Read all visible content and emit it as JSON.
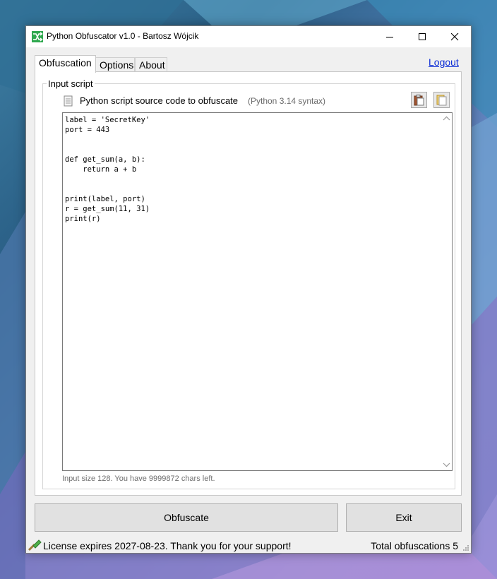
{
  "window": {
    "title": "Python Obfuscator v1.0 - Bartosz Wójcik"
  },
  "tabs": [
    {
      "label": "Obfuscation",
      "active": true
    },
    {
      "label": "Options",
      "active": false
    },
    {
      "label": "About",
      "active": false
    }
  ],
  "logout_label": "Logout",
  "input_group": {
    "label": "Input script",
    "source_label": "Python script source code to obfuscate",
    "syntax_label": "(Python 3.14 syntax)",
    "paste_icon": "clipboard-paste-icon",
    "open_icon": "open-file-icon",
    "code_lines": [
      "label = 'SecretKey'",
      "port = 443",
      "",
      "",
      "def get_sum(a, b):",
      "    return a + b",
      "",
      "",
      "print(label, port)",
      "r = get_sum(11, 31)",
      "print(r)"
    ],
    "size_text": "Input size 128. You have 9999872 chars left."
  },
  "buttons": {
    "obfuscate": "Obfuscate",
    "exit": "Exit"
  },
  "status": {
    "license": "License expires 2027-08-23. Thank you for your support!",
    "total": "Total obfuscations 5"
  },
  "colors": {
    "link": "#0a2bd6",
    "app_icon": "#2fa84f"
  }
}
